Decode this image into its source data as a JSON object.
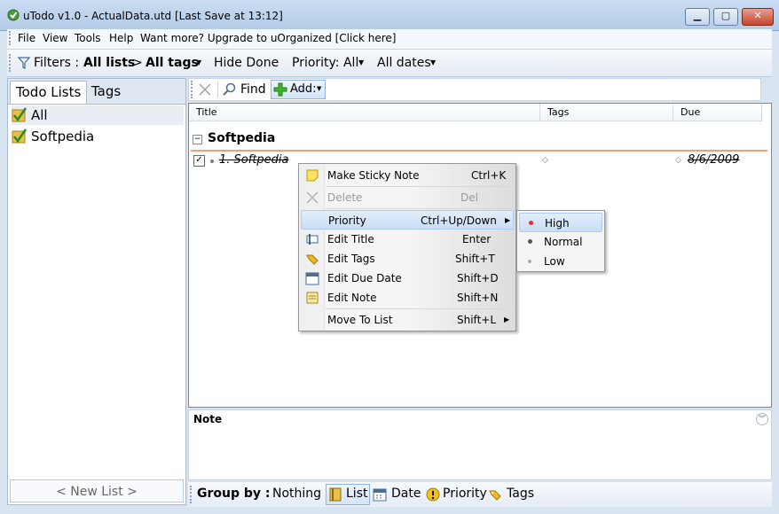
{
  "window": {
    "title": "uTodo v1.0 - ActualData.utd   [Last Save at 13:12]",
    "controls": {
      "minimize": "▁",
      "maximize": "▢",
      "close": "✕"
    }
  },
  "menu": {
    "file": "File",
    "view": "View",
    "tools": "Tools",
    "help": "Help",
    "upgrade": "Want more? Upgrade to uOrganized [Click here]"
  },
  "filters": {
    "label": "Filters :",
    "lists": "All lists",
    "sep": ">",
    "tags": "All tags",
    "hide_done": "Hide Done",
    "priority": "Priority: All",
    "dates": "All dates"
  },
  "left": {
    "tab_lists": "Todo Lists",
    "tab_tags": "Tags",
    "items": [
      "All",
      "Softpedia"
    ],
    "new_list": "< New List >"
  },
  "toolbar": {
    "find": "Find",
    "add": "Add:"
  },
  "grid": {
    "columns": [
      "Title",
      "Tags",
      "Due"
    ],
    "group": "Softpedia",
    "task": {
      "title": "1. Softpedia",
      "due": "8/6/2009",
      "done": true
    }
  },
  "note": {
    "label": "Note"
  },
  "groupby": {
    "label": "Group by :",
    "options": [
      "Nothing",
      "List",
      "Date",
      "Priority",
      "Tags"
    ]
  },
  "context_menu": {
    "items": [
      {
        "label": "Make Sticky Note",
        "shortcut": "Ctrl+K"
      },
      {
        "label": "Delete",
        "shortcut": "Del"
      },
      {
        "label": "Priority",
        "shortcut": "Ctrl+Up/Down"
      },
      {
        "label": "Edit Title",
        "shortcut": "Enter"
      },
      {
        "label": "Edit Tags",
        "shortcut": "Shift+T"
      },
      {
        "label": "Edit Due Date",
        "shortcut": "Shift+D"
      },
      {
        "label": "Edit Note",
        "shortcut": "Shift+N"
      },
      {
        "label": "Move To List",
        "shortcut": "Shift+L"
      }
    ],
    "priority_submenu": [
      "High",
      "Normal",
      "Low"
    ]
  },
  "colors": {
    "accent_orange": "#f0a078",
    "priority_high": "#e03030",
    "highlight": "#c9ddf6"
  }
}
